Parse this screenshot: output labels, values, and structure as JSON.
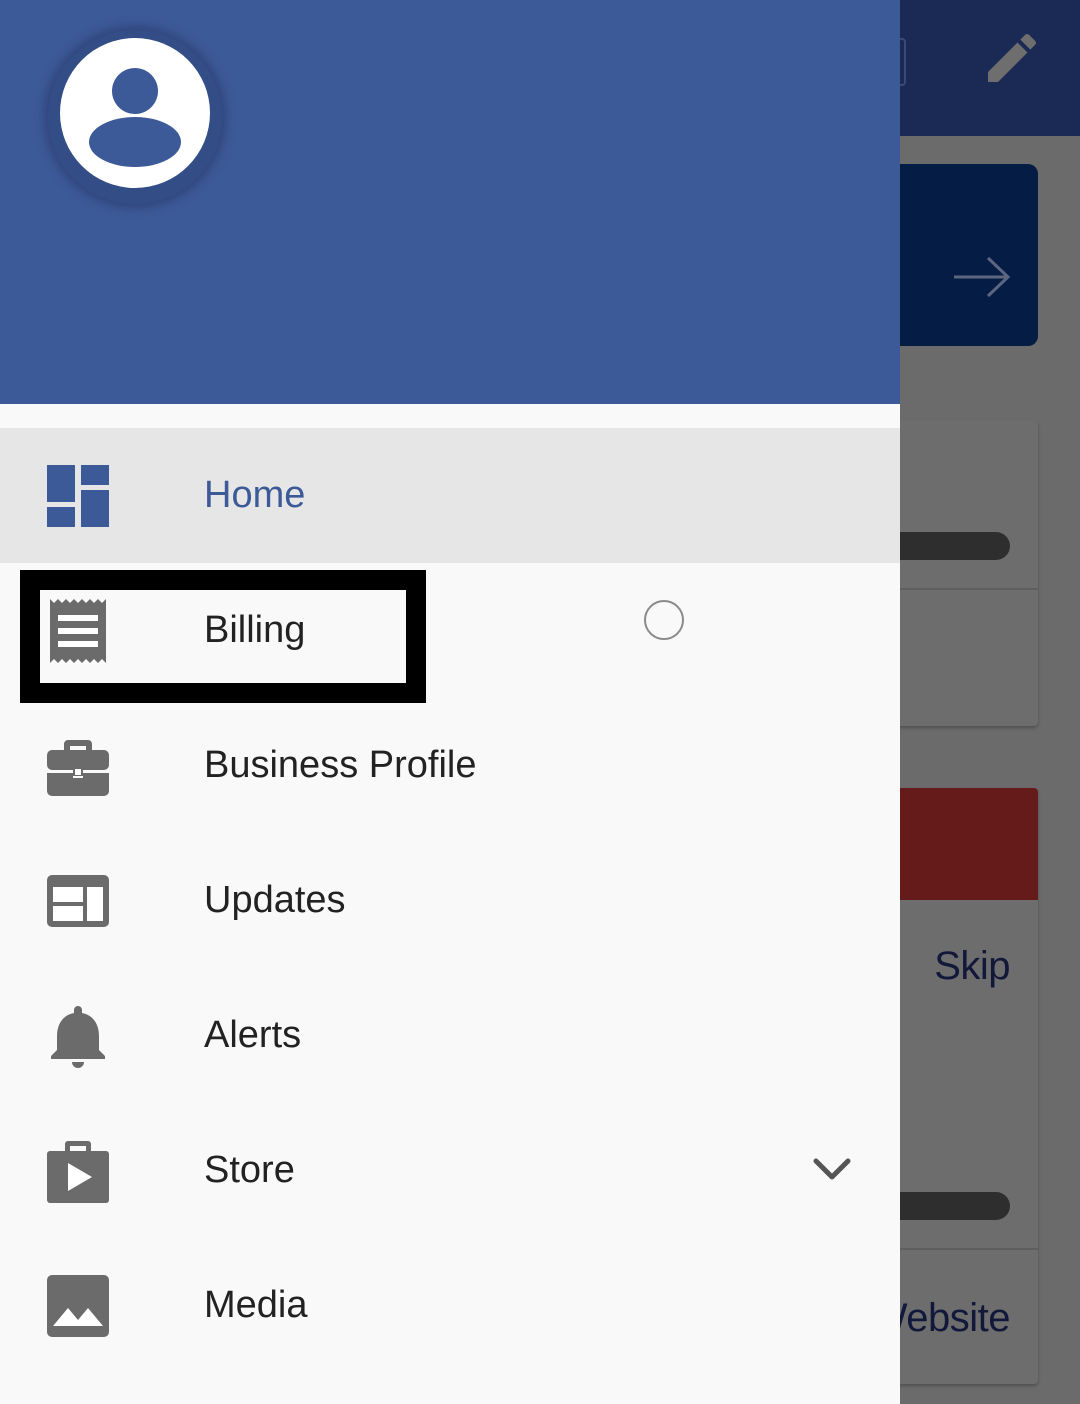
{
  "background": {
    "skip_label": "Skip",
    "website_label": "Website"
  },
  "drawer": {
    "header_color": "#3d5a98",
    "accent_color": "#3d5a98",
    "items": [
      {
        "label": "Home",
        "icon": "dashboard-icon",
        "active": true
      },
      {
        "label": "Billing",
        "icon": "receipt-icon",
        "active": false,
        "highlighted": true
      },
      {
        "label": "Business Profile",
        "icon": "briefcase-icon",
        "active": false
      },
      {
        "label": "Updates",
        "icon": "web-article-icon",
        "active": false
      },
      {
        "label": "Alerts",
        "icon": "bell-icon",
        "active": false
      },
      {
        "label": "Store",
        "icon": "store-bag-icon",
        "active": false,
        "expandable": true
      },
      {
        "label": "Media",
        "icon": "image-icon",
        "active": false
      }
    ]
  }
}
